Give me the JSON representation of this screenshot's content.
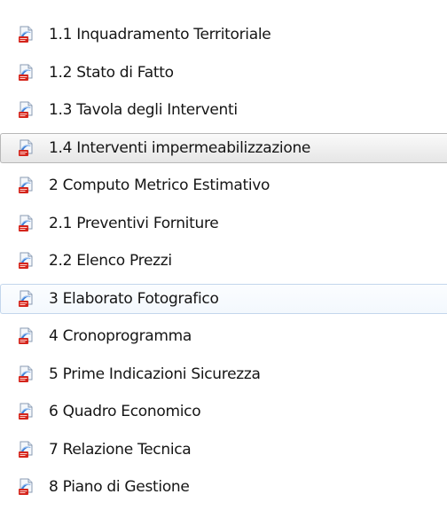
{
  "file_list": {
    "items": [
      {
        "label": "1.1 Inquadramento Territoriale",
        "icon": "pdf-file-icon",
        "state": "normal"
      },
      {
        "label": "1.2 Stato di Fatto",
        "icon": "pdf-file-icon",
        "state": "normal"
      },
      {
        "label": "1.3 Tavola degli Interventi",
        "icon": "pdf-file-icon",
        "state": "normal"
      },
      {
        "label": "1.4 Interventi impermeabilizzazione",
        "icon": "pdf-file-icon",
        "state": "selected"
      },
      {
        "label": "2 Computo Metrico Estimativo",
        "icon": "pdf-file-icon",
        "state": "normal"
      },
      {
        "label": "2.1 Preventivi Forniture",
        "icon": "pdf-file-icon",
        "state": "normal"
      },
      {
        "label": "2.2 Elenco Prezzi",
        "icon": "pdf-file-icon",
        "state": "normal"
      },
      {
        "label": "3 Elaborato Fotografico",
        "icon": "pdf-file-icon",
        "state": "hover"
      },
      {
        "label": "4 Cronoprogramma",
        "icon": "pdf-file-icon",
        "state": "normal"
      },
      {
        "label": "5 Prime Indicazioni Sicurezza",
        "icon": "pdf-file-icon",
        "state": "normal"
      },
      {
        "label": "6 Quadro Economico",
        "icon": "pdf-file-icon",
        "state": "normal"
      },
      {
        "label": "7 Relazione Tecnica",
        "icon": "pdf-file-icon",
        "state": "normal"
      },
      {
        "label": "8 Piano di Gestione",
        "icon": "pdf-file-icon",
        "state": "normal"
      }
    ]
  },
  "colors": {
    "text": "#151515",
    "selected_border": "#b8b8b8",
    "hover_border": "#c3d6ec",
    "icon_red": "#d4251c",
    "icon_blue": "#3a7bd5"
  }
}
